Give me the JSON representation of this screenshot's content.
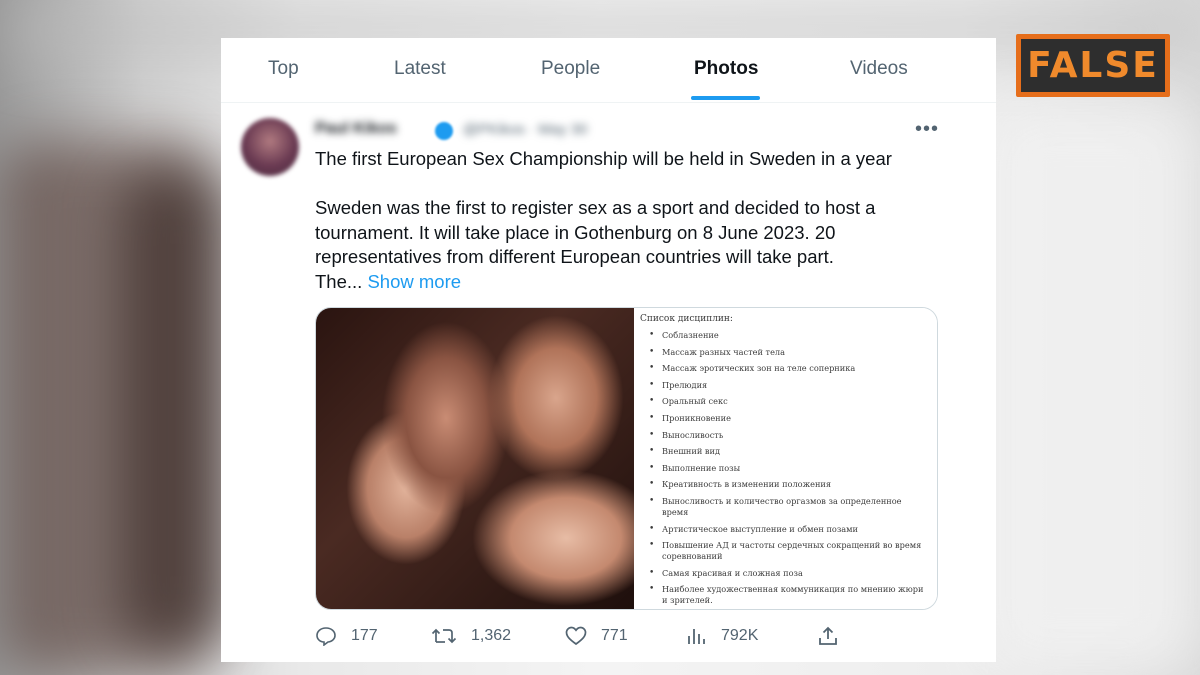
{
  "tabs": [
    {
      "label": "Top"
    },
    {
      "label": "Latest"
    },
    {
      "label": "People"
    },
    {
      "label": "Photos",
      "active": true
    },
    {
      "label": "Videos"
    }
  ],
  "tweet": {
    "author_name": "Paul Kikos",
    "author_meta": "@PKikos · May 30",
    "line1": "The first European Sex Championship will be held in Sweden in a year",
    "line2": "Sweden was the first to register sex as a sport and decided to host a",
    "line3": "tournament. It will take place in Gothenburg on 8 June 2023. 20",
    "line4": "representatives from different European countries will take part.",
    "line5": "The...",
    "show_more": "Show more",
    "media": {
      "list_title": "Список дисциплин:",
      "items": [
        "Соблазнение",
        "Массаж разных частей тела",
        "Массаж эротических зон на теле соперника",
        "Прелюдия",
        "Оральный секс",
        "Проникновение",
        "Выносливость",
        "Внешний вид",
        "Выполнение позы",
        "Креативность в изменении положения",
        "Выносливость и количество оргазмов за определенное время",
        "Артистическое выступление и обмен позами",
        "Повышение АД и частоты сердечных сокращений во время соревнований",
        "Самая красивая и сложная поза",
        "Наиболее художественная коммуникация по мнению жюри и зрителей."
      ]
    },
    "actions": {
      "replies": "177",
      "retweets": "1,362",
      "likes": "771",
      "views": "792K"
    }
  },
  "badge": {
    "label": "FALSE",
    "accent": "#e66e1b"
  },
  "colors": {
    "link": "#1d9bf0",
    "text": "#0f1419",
    "muted": "#536471"
  }
}
